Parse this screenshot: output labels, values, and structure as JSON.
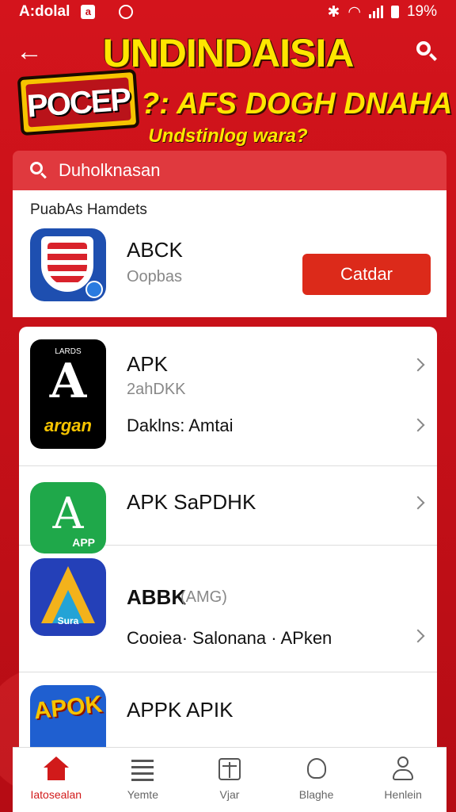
{
  "status_bar": {
    "carrier": "A:dolal",
    "notif": "a",
    "battery": "19%"
  },
  "header": {
    "title": "UNDINDAISIA",
    "logo_text": "POCEP",
    "subtitle": "?: AFS DOGH DNAHA",
    "tagline": "Undstinlog wara?"
  },
  "search": {
    "placeholder": "Duholknasan"
  },
  "featured": {
    "section_label": "PuabAs Hamdets",
    "name": "ABCK",
    "subtitle": "Oopbas",
    "button_label": "Catdar"
  },
  "apps": [
    {
      "name": "APK",
      "sub": "2ahDKK",
      "desc": "Daklns: Amtai",
      "icon_text": "A",
      "icon_caption": "argan",
      "icon_top": "LARDS"
    },
    {
      "name": "APK SaPDHK",
      "icon_text": "A",
      "icon_caption": "APP"
    },
    {
      "name": "ABBK",
      "sub": "(AMG)",
      "desc": "Cooiea· Salonana · APken",
      "icon_caption": "Sura"
    },
    {
      "name": "APPK APIK",
      "icon_text": "APOK"
    }
  ],
  "bottom_nav": [
    {
      "label": "Iatosealan",
      "icon": "home-icon"
    },
    {
      "label": "Yemte",
      "icon": "list-icon"
    },
    {
      "label": "Vjar",
      "icon": "box-icon"
    },
    {
      "label": "Blaghe",
      "icon": "face-icon"
    },
    {
      "label": "Henlein",
      "icon": "user-icon"
    }
  ],
  "colors": {
    "primary": "#c8101a",
    "accent": "#ffe600",
    "button": "#dc2a1a"
  }
}
